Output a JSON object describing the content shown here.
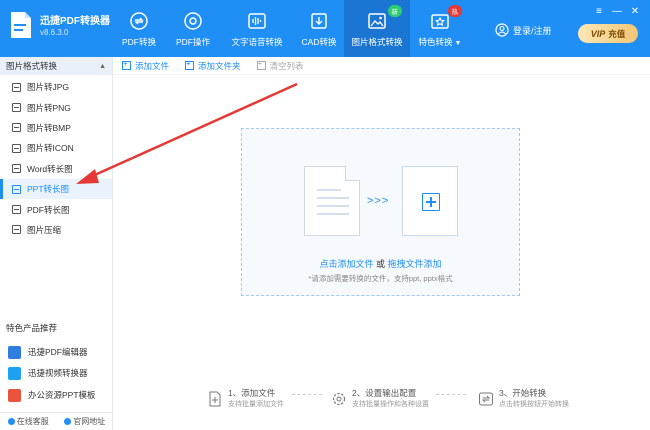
{
  "app": {
    "name": "迅捷PDF转换器",
    "version": "v8.6.3.0"
  },
  "nav": [
    {
      "label": "PDF转换",
      "icon": "pdf-convert-icon"
    },
    {
      "label": "PDF操作",
      "icon": "pdf-operate-icon"
    },
    {
      "label": "文字语音转换",
      "icon": "voice-icon"
    },
    {
      "label": "CAD转换",
      "icon": "cad-icon"
    },
    {
      "label": "图片格式转换",
      "icon": "image-icon",
      "badge": "新",
      "active": true
    },
    {
      "label": "特色转换",
      "icon": "feature-icon",
      "badge": "热"
    }
  ],
  "login_label": "登录/注册",
  "vip": {
    "tag": "VIP",
    "label": "充值"
  },
  "window_controls": [
    "≡",
    "—",
    "✕"
  ],
  "sidebar": {
    "section_title": "图片格式转换",
    "items": [
      {
        "label": "图片转JPG"
      },
      {
        "label": "图片转PNG"
      },
      {
        "label": "图片转BMP"
      },
      {
        "label": "图片转ICON"
      },
      {
        "label": "Word转长图"
      },
      {
        "label": "PPT转长图",
        "active": true
      },
      {
        "label": "PDF转长图"
      },
      {
        "label": "图片压缩"
      }
    ],
    "featured_title": "特色产品推荐",
    "products": [
      {
        "label": "迅捷PDF编辑器",
        "color": "#2f7de1"
      },
      {
        "label": "迅捷视频转换器",
        "color": "#1da1f2"
      },
      {
        "label": "办公资源PPT模板",
        "color": "#e8553c"
      }
    ],
    "footer": {
      "service": "在线客服",
      "website": "官网地址"
    }
  },
  "toolbar": {
    "add_file": "添加文件",
    "add_folder": "添加文件夹",
    "clear_list": "清空列表"
  },
  "dropzone": {
    "link_add": "点击添加文件",
    "or": " 或 ",
    "link_drag": "拖拽文件添加",
    "hint": "*请添加需要转换的文件，支持ppt, pptx格式"
  },
  "steps": [
    {
      "title": "1、添加文件",
      "desc": "支持批量添加文件"
    },
    {
      "title": "2、设置输出配置",
      "desc": "支持批量操作和各种设置"
    },
    {
      "title": "3、开始转换",
      "desc": "点击转换按钮开始转换"
    }
  ],
  "colors": {
    "primary": "#1f8ef5",
    "annotation": "#e53935"
  }
}
